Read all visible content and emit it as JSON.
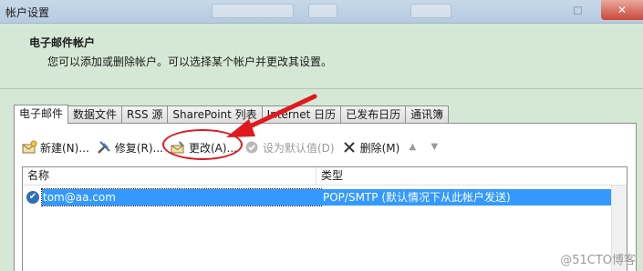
{
  "window": {
    "title": "帐户设置",
    "close_label": "✕"
  },
  "header": {
    "title": "电子邮件帐户",
    "description": "您可以添加或删除帐户。可以选择某个帐户并更改其设置。"
  },
  "tabs": [
    {
      "label": "电子邮件",
      "active": true
    },
    {
      "label": "数据文件"
    },
    {
      "label": "RSS 源"
    },
    {
      "label": "SharePoint 列表"
    },
    {
      "label": "Internet 日历"
    },
    {
      "label": "已发布日历"
    },
    {
      "label": "通讯簿"
    }
  ],
  "toolbar": {
    "new_label": "新建(N)...",
    "repair_label": "修复(R)...",
    "change_label": "更改(A)...",
    "default_label": "设为默认值(D)",
    "remove_label": "删除(M)",
    "up_icon": "▲",
    "down_icon": "▼"
  },
  "list": {
    "columns": [
      "名称",
      "类型"
    ],
    "rows": [
      {
        "name": "tom@aa.com",
        "type": "POP/SMTP (默认情况下从此帐户发送)",
        "default": true
      }
    ]
  },
  "watermark": "@51CTO博客",
  "colors": {
    "accent": "#3399ff",
    "annotation": "#e0191f",
    "background": "#d5e8d5"
  }
}
